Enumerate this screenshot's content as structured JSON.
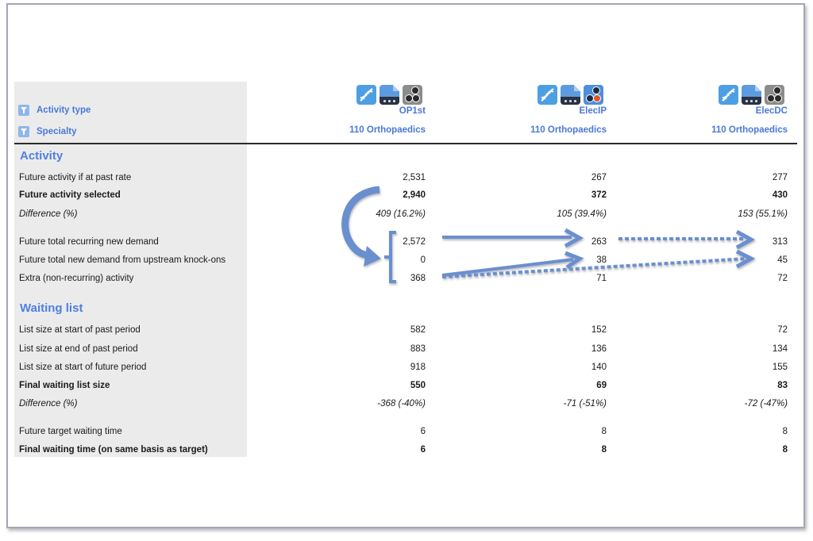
{
  "filters": [
    {
      "icon": "filter-icon",
      "label": "Activity type"
    },
    {
      "icon": "filter-icon",
      "label": "Specialty"
    }
  ],
  "columns": [
    {
      "code": "OP1st",
      "specialty": "110 Orthopaedics",
      "icons": [
        "dna-icon",
        "document-icon",
        "dots-icon-grey"
      ]
    },
    {
      "code": "ElecIP",
      "specialty": "110 Orthopaedics",
      "icons": [
        "dna-icon",
        "document-icon",
        "dots-icon-highlighted"
      ]
    },
    {
      "code": "ElecDC",
      "specialty": "110 Orthopaedics",
      "icons": [
        "dna-icon",
        "document-icon",
        "dots-icon-grey"
      ]
    }
  ],
  "sections": {
    "activity": {
      "title": "Activity",
      "rows": [
        {
          "label": "Future activity if at past rate",
          "style": "normal",
          "values": [
            "2,531",
            "267",
            "277"
          ]
        },
        {
          "label": "Future activity selected",
          "style": "bold",
          "values": [
            "2,940",
            "372",
            "430"
          ]
        },
        {
          "label": "Difference (%)",
          "style": "italic",
          "values": [
            "409 (16.2%)",
            "105 (39.4%)",
            "153 (55.1%)"
          ]
        },
        {
          "label": "Future total recurring new demand",
          "style": "normal",
          "values": [
            "2,572",
            "263",
            "313"
          ]
        },
        {
          "label": "Future total new demand from upstream knock-ons",
          "style": "normal",
          "values": [
            "0",
            "38",
            "45"
          ]
        },
        {
          "label": "Extra (non-recurring) activity",
          "style": "normal",
          "values": [
            "368",
            "71",
            "72"
          ]
        }
      ]
    },
    "waiting_list": {
      "title": "Waiting list",
      "rows": [
        {
          "label": "List size at start of past period",
          "style": "normal",
          "values": [
            "582",
            "152",
            "72"
          ]
        },
        {
          "label": "List size at end of past period",
          "style": "normal",
          "values": [
            "883",
            "136",
            "134"
          ]
        },
        {
          "label": "List size at start of future period",
          "style": "normal",
          "values": [
            "918",
            "140",
            "155"
          ]
        },
        {
          "label": "Final waiting list size",
          "style": "bold",
          "values": [
            "550",
            "69",
            "83"
          ]
        },
        {
          "label": "Difference (%)",
          "style": "italic",
          "values": [
            "-368 (-40%)",
            "-71 (-51%)",
            "-72 (-47%)"
          ]
        },
        {
          "label": "Future target waiting time",
          "style": "normal",
          "values": [
            "6",
            "8",
            "8"
          ]
        },
        {
          "label": "Final waiting time (on same basis as target)",
          "style": "bold",
          "values": [
            "6",
            "8",
            "8"
          ]
        }
      ]
    }
  },
  "annotations": {
    "color": "#6a8fcf",
    "items": [
      "curved-arrow",
      "bracket",
      "solid-arrow-recurring",
      "solid-arrow-extra",
      "dotted-arrow-recurring",
      "dotted-arrow-extra"
    ]
  }
}
